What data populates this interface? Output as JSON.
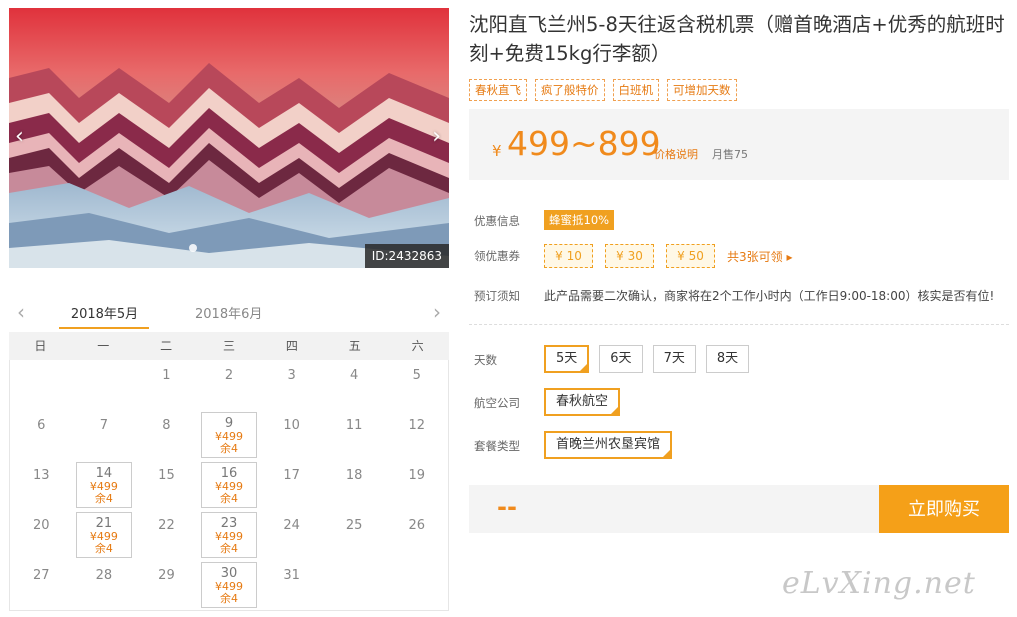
{
  "hero": {
    "prev_icon": "chevron-left-icon",
    "next_icon": "chevron-right-icon",
    "prev_glyph": "‹",
    "next_glyph": "›",
    "id_label": "ID:2432863"
  },
  "calendar": {
    "prev_glyph": "‹",
    "next_glyph": "›",
    "tabs": [
      "2018年5月",
      "2018年6月"
    ],
    "weekdays": [
      "日",
      "一",
      "二",
      "三",
      "四",
      "五",
      "六"
    ],
    "weeks": [
      [
        {
          "d": ""
        },
        {
          "d": ""
        },
        {
          "d": "1"
        },
        {
          "d": "2"
        },
        {
          "d": "3"
        },
        {
          "d": "4"
        },
        {
          "d": "5"
        }
      ],
      [
        {
          "d": "6"
        },
        {
          "d": "7"
        },
        {
          "d": "8"
        },
        {
          "d": "9",
          "p": "¥499",
          "s": "余4"
        },
        {
          "d": "10"
        },
        {
          "d": "11"
        },
        {
          "d": "12"
        }
      ],
      [
        {
          "d": "13"
        },
        {
          "d": "14",
          "p": "¥499",
          "s": "余4"
        },
        {
          "d": "15"
        },
        {
          "d": "16",
          "p": "¥499",
          "s": "余4"
        },
        {
          "d": "17"
        },
        {
          "d": "18"
        },
        {
          "d": "19"
        }
      ],
      [
        {
          "d": "20"
        },
        {
          "d": "21",
          "p": "¥499",
          "s": "余4"
        },
        {
          "d": "22"
        },
        {
          "d": "23",
          "p": "¥499",
          "s": "余4"
        },
        {
          "d": "24"
        },
        {
          "d": "25"
        },
        {
          "d": "26"
        }
      ],
      [
        {
          "d": "27"
        },
        {
          "d": "28"
        },
        {
          "d": "29"
        },
        {
          "d": "30",
          "p": "¥499",
          "s": "余4"
        },
        {
          "d": "31"
        },
        {
          "d": ""
        },
        {
          "d": ""
        }
      ]
    ]
  },
  "product": {
    "title": "沈阳直飞兰州5-8天往返含税机票（赠首晚酒店+优秀的航班时刻+免费15kg行李额）",
    "tags": [
      "春秋直飞",
      "疯了般特价",
      "白班机",
      "可增加天数"
    ],
    "price_symbol": "¥",
    "price_range": "499~899",
    "price_note": "价格说明",
    "monthly_sold": "月售75"
  },
  "info": {
    "discount_label": "优惠信息",
    "discount_badge": "蜂蜜抵10%",
    "coupon_label": "领优惠券",
    "coupons": [
      "¥ 10",
      "¥ 30",
      "¥ 50"
    ],
    "coupon_more": "共3张可领 ▸",
    "notice_label": "预订须知",
    "notice_text": "此产品需要二次确认，商家将在2个工作小时内（工作日9:00-18:00）核实是否有位!"
  },
  "options": {
    "days_label": "天数",
    "days": [
      "5天",
      "6天",
      "7天",
      "8天"
    ],
    "airline_label": "航空公司",
    "airline": "春秋航空",
    "package_label": "套餐类型",
    "package": "首晚兰州农垦宾馆"
  },
  "purchase": {
    "total": "--",
    "buy_label": "立即购买"
  },
  "watermark": "eLvXing.net",
  "colors": {
    "accent": "#f0a020",
    "price": "#f08a1c",
    "buy_button": "#f5a018"
  }
}
